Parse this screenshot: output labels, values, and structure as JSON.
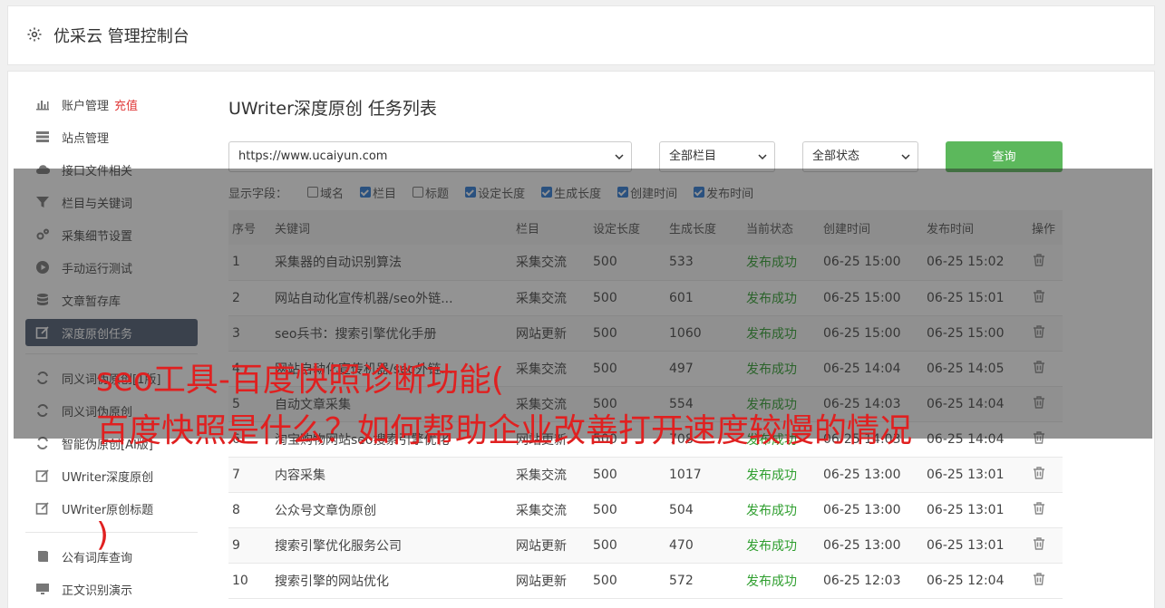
{
  "header": {
    "title": "优采云 管理控制台",
    "icon": "gear-icon"
  },
  "sidebar": {
    "items": [
      {
        "label": "账户管理",
        "badge": "充值",
        "icon": "bar-chart-icon"
      },
      {
        "label": "站点管理",
        "icon": "server-icon"
      },
      {
        "label": "接口文件相关",
        "icon": "cloud-upload-icon"
      },
      {
        "label": "栏目与关键词",
        "icon": "filter-icon"
      },
      {
        "label": "采集细节设置",
        "icon": "gears-icon"
      },
      {
        "label": "手动运行测试",
        "icon": "play-circle-icon"
      },
      {
        "label": "文章暂存库",
        "icon": "database-icon"
      },
      {
        "label": "深度原创任务",
        "icon": "edit-icon",
        "active": true
      }
    ],
    "items2": [
      {
        "label": "同义词伪原创[1版]",
        "icon": "refresh-icon"
      },
      {
        "label": "同义词伪原创",
        "icon": "refresh-icon"
      },
      {
        "label": "智能伪原创[AI版]",
        "icon": "refresh-icon"
      },
      {
        "label": "UWriter深度原创",
        "icon": "edit-icon"
      },
      {
        "label": "UWriter原创标题",
        "icon": "edit-icon"
      }
    ],
    "items3": [
      {
        "label": "公有词库查询",
        "icon": "book-icon"
      },
      {
        "label": "正文识别演示",
        "icon": "monitor-icon"
      }
    ]
  },
  "main": {
    "title": "UWriter深度原创 任务列表",
    "site_select": "https://www.ucaiyun.com",
    "column_select": "全部栏目",
    "status_select": "全部状态",
    "query_label": "查询",
    "fields_label": "显示字段：",
    "fields": [
      {
        "label": "域名",
        "checked": false
      },
      {
        "label": "栏目",
        "checked": true
      },
      {
        "label": "标题",
        "checked": false
      },
      {
        "label": "设定长度",
        "checked": true
      },
      {
        "label": "生成长度",
        "checked": true
      },
      {
        "label": "创建时间",
        "checked": true
      },
      {
        "label": "发布时间",
        "checked": true
      }
    ],
    "columns": [
      "序号",
      "关键词",
      "栏目",
      "设定长度",
      "生成长度",
      "当前状态",
      "创建时间",
      "发布时间",
      "操作"
    ],
    "rows": [
      [
        "1",
        "采集器的自动识别算法",
        "采集交流",
        "500",
        "533",
        "发布成功",
        "06-25 15:00",
        "06-25 15:02"
      ],
      [
        "2",
        "网站自动化宣传机器/seo外链...",
        "采集交流",
        "500",
        "601",
        "发布成功",
        "06-25 15:00",
        "06-25 15:01"
      ],
      [
        "3",
        "seo兵书：搜索引擎优化手册",
        "网站更新",
        "500",
        "1060",
        "发布成功",
        "06-25 15:00",
        "06-25 15:00"
      ],
      [
        "4",
        "网站自动化宣传机器/seo外链...",
        "采集交流",
        "500",
        "497",
        "发布成功",
        "06-25 14:04",
        "06-25 14:05"
      ],
      [
        "5",
        "自动文章采集",
        "采集交流",
        "500",
        "554",
        "发布成功",
        "06-25 14:03",
        "06-25 14:04"
      ],
      [
        "6",
        "淘宝购物网站seo搜索引擎优化",
        "网站更新",
        "500",
        "708",
        "发布成功",
        "06-25 14:03",
        "06-25 14:04"
      ],
      [
        "7",
        "内容采集",
        "采集交流",
        "500",
        "1017",
        "发布成功",
        "06-25 13:00",
        "06-25 13:01"
      ],
      [
        "8",
        "公众号文章伪原创",
        "采集交流",
        "500",
        "504",
        "发布成功",
        "06-25 13:00",
        "06-25 13:01"
      ],
      [
        "9",
        "搜索引擎优化服务公司",
        "网站更新",
        "500",
        "470",
        "发布成功",
        "06-25 13:00",
        "06-25 13:01"
      ],
      [
        "10",
        "搜索引擎的网站优化",
        "网站更新",
        "500",
        "572",
        "发布成功",
        "06-25 12:03",
        "06-25 12:04"
      ]
    ]
  },
  "overlay": {
    "line1": "seo工具-百度快照诊断功能(",
    "line2": "百度快照是什么？如何帮助企业改善打开速度较慢的情况",
    "line3": ")"
  },
  "colors": {
    "accent": "#5cb85c",
    "active_nav": "#4d5a70",
    "success": "#2e9e2e",
    "overlay_text": "#e02020"
  }
}
